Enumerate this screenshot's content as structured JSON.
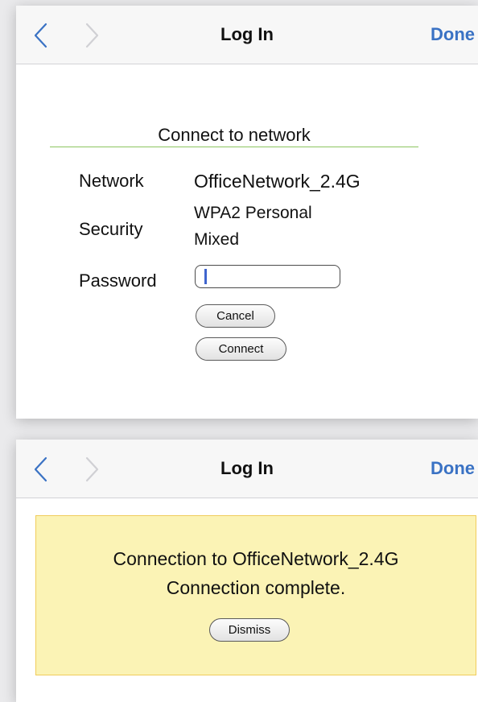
{
  "panels": [
    {
      "nav": {
        "back_icon": "chevron-left-icon",
        "forward_icon": "chevron-right-icon",
        "title": "Log In",
        "done": "Done"
      },
      "form": {
        "heading": "Connect to network",
        "network_label": "Network",
        "network_value": "OfficeNetwork_2.4G",
        "security_label": "Security",
        "security_value_line1": "WPA2 Personal",
        "security_value_line2": "Mixed",
        "password_label": "Password",
        "password_value": "",
        "cancel": "Cancel",
        "connect": "Connect"
      }
    },
    {
      "nav": {
        "back_icon": "chevron-left-icon",
        "forward_icon": "chevron-right-icon",
        "title": "Log In",
        "done": "Done"
      },
      "notice": {
        "line1": "Connection to OfficeNetwork_2.4G",
        "line2": "Connection complete.",
        "dismiss": "Dismiss"
      }
    }
  ],
  "colors": {
    "accent": "#3a72c4",
    "divider_green": "#8dc45f",
    "notice_bg": "#fbf3b5",
    "notice_border": "#f0cc5b",
    "caret": "#3f64ce"
  }
}
